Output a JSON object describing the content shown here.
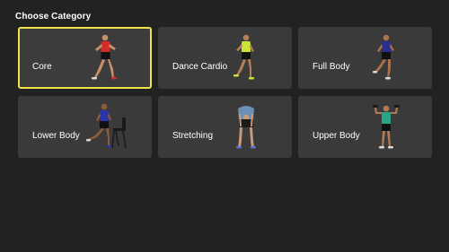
{
  "header": {
    "title": "Choose Category"
  },
  "categories": [
    {
      "label": "Core",
      "selected": true,
      "shirt_color": "#d42a2a",
      "shorts_color": "#111111",
      "pose": "lean-walk",
      "image": "core-workout-figure"
    },
    {
      "label": "Dance Cardio",
      "selected": false,
      "shirt_color": "#c8e33a",
      "shorts_color": "#111111",
      "pose": "dance-step",
      "image": "dance-cardio-figure"
    },
    {
      "label": "Full Body",
      "selected": false,
      "shirt_color": "#2a2f8f",
      "shorts_color": "#111111",
      "pose": "lunge-run",
      "image": "full-body-figure"
    },
    {
      "label": "Lower Body",
      "selected": false,
      "shirt_color": "#2a36a8",
      "shorts_color": "#111111",
      "pose": "chair-step",
      "image": "lower-body-figure"
    },
    {
      "label": "Stretching",
      "selected": false,
      "shirt_color": "#6b8fb5",
      "shorts_color": "#1a1a1a",
      "pose": "forward-fold",
      "image": "stretching-figure"
    },
    {
      "label": "Upper Body",
      "selected": false,
      "shirt_color": "#2aa58a",
      "shorts_color": "#111111",
      "pose": "dumbbell-curl",
      "image": "upper-body-figure"
    }
  ],
  "colors": {
    "background": "#222222",
    "tile": "#3a3a3a",
    "focus_border": "#f0e44a",
    "text": "#ffffff"
  }
}
